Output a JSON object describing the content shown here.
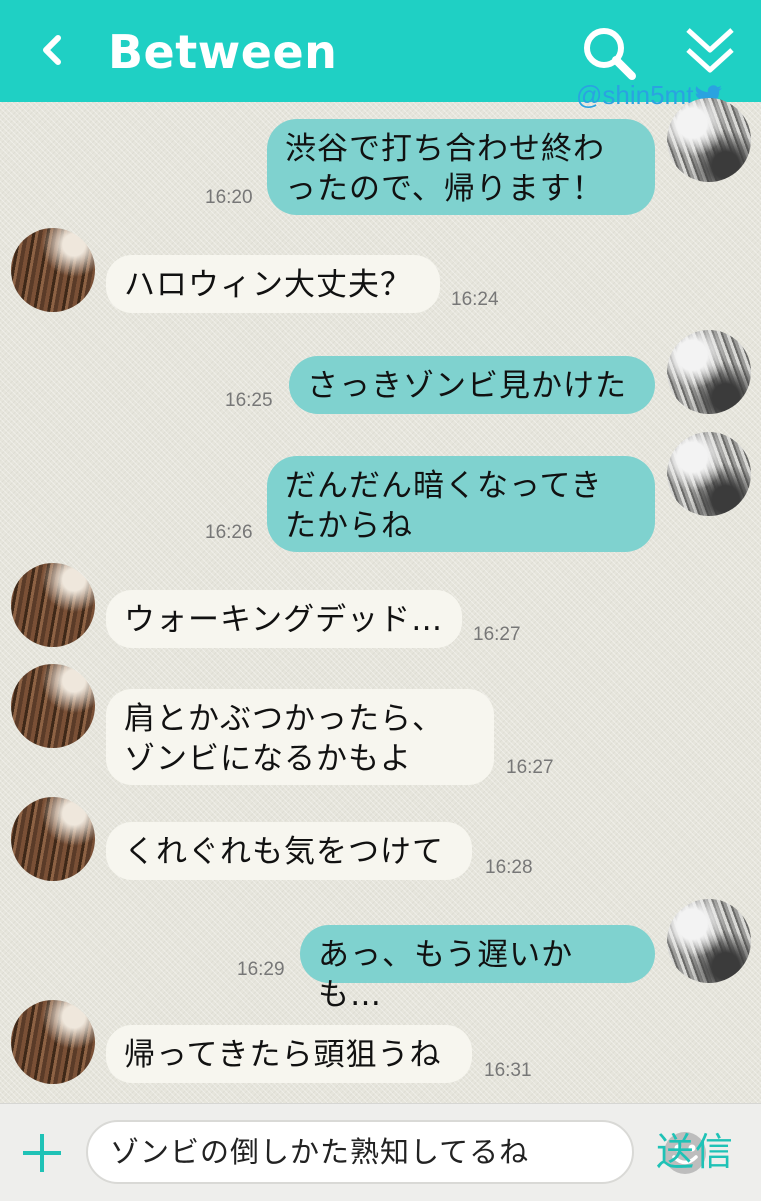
{
  "header": {
    "back_icon": "chevron-left-icon",
    "title": "Between",
    "search_icon": "search-icon",
    "collapse_icon": "double-chevron-down-icon",
    "background": "#1fd0c4"
  },
  "watermark": "@shin5mt",
  "messages": [
    {
      "side": "sent",
      "text": "渋谷で打ち合わせ終わ\nったので、帰ります！",
      "time": "16:20"
    },
    {
      "side": "recv",
      "text": "ハロウィン大丈夫？",
      "time": "16:24"
    },
    {
      "side": "sent",
      "text": "さっきゾンビ見かけた",
      "time": "16:25"
    },
    {
      "side": "sent",
      "text": "だんだん暗くなってき\nたからね",
      "time": "16:26"
    },
    {
      "side": "recv",
      "text": "ウォーキングデッド…",
      "time": "16:27"
    },
    {
      "side": "recv",
      "text": "肩とかぶつかったら、\nゾンビになるかもよ",
      "time": "16:27"
    },
    {
      "side": "recv",
      "text": "くれぐれも気をつけて",
      "time": "16:28"
    },
    {
      "side": "sent",
      "text": "あっ、もう遅いかも…",
      "time": "16:29"
    },
    {
      "side": "recv",
      "text": "帰ってきたら頭狙うね",
      "time": "16:31"
    }
  ],
  "input_bar": {
    "attach_icon": "plus-icon",
    "input_value": "ゾンビの倒しかた熟知してるね",
    "emoji_icon": "smiley-icon",
    "send_label": "送信",
    "accent": "#1fc2b6"
  }
}
